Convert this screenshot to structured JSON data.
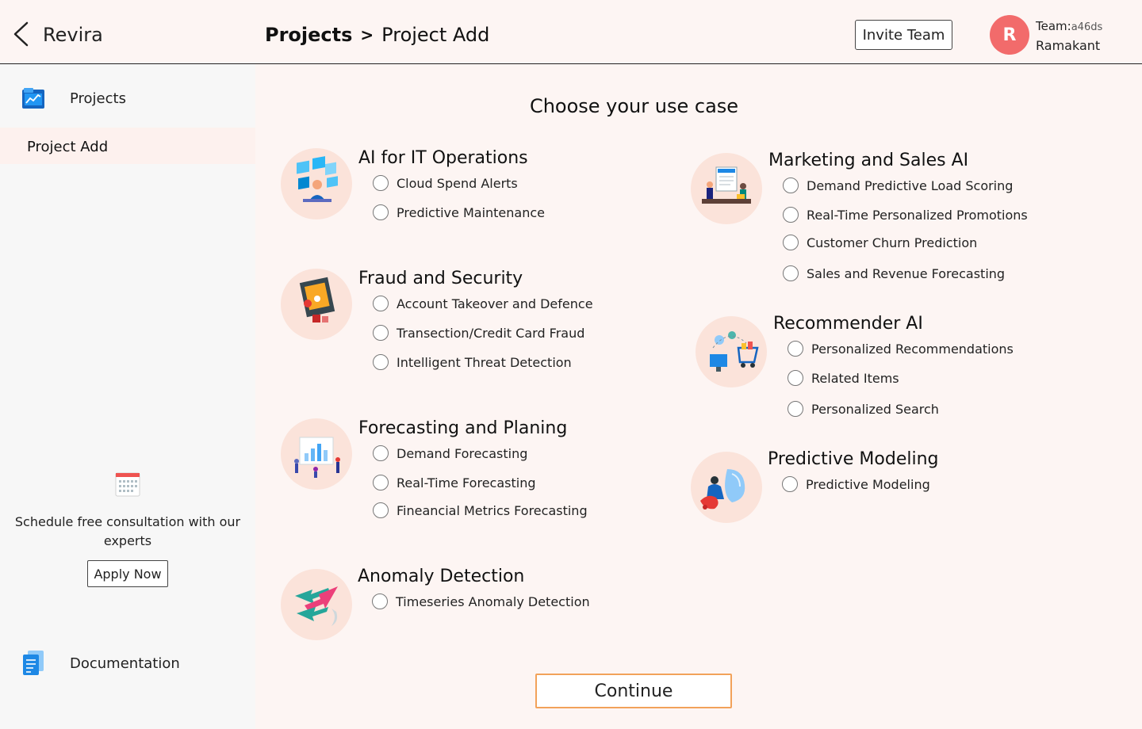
{
  "header": {
    "app_name": "Revira",
    "breadcrumb": {
      "parent": "Projects",
      "separator": ">",
      "current": "Project Add"
    },
    "invite_label": "Invite Team",
    "avatar_initial": "R",
    "team_prefix": "Team:",
    "team_id": "a46ds",
    "user_name": "Ramakant"
  },
  "sidebar": {
    "projects_label": "Projects",
    "project_add_label": "Project Add",
    "consult_text": "Schedule free consultation with our experts",
    "apply_label": "Apply Now",
    "docs_label": "Documentation"
  },
  "main": {
    "title": "Choose your use case",
    "groups": [
      {
        "title": "AI for IT Operations",
        "options": [
          "Cloud Spend Alerts",
          "Predictive Maintenance"
        ]
      },
      {
        "title": "Fraud and Security",
        "options": [
          "Account Takeover and Defence",
          "Transection/Credit Card Fraud",
          "Intelligent Threat Detection"
        ]
      },
      {
        "title": "Forecasting and Planing",
        "options": [
          "Demand Forecasting",
          "Real-Time Forecasting",
          "Fineancial Metrics Forecasting"
        ]
      },
      {
        "title": "Anomaly Detection",
        "options": [
          "Timeseries Anomaly Detection"
        ]
      },
      {
        "title": "Marketing and Sales AI",
        "options": [
          "Demand Predictive Load Scoring",
          "Real-Time Personalized Promotions",
          "Customer Churn Prediction",
          "Sales and Revenue Forecasting"
        ]
      },
      {
        "title": "Recommender AI",
        "options": [
          "Personalized Recommendations",
          "Related Items",
          "Personalized Search"
        ]
      },
      {
        "title": "Predictive Modeling",
        "options": [
          "Predictive Modeling"
        ]
      }
    ],
    "continue_label": "Continue"
  },
  "colors": {
    "accent": "#f26b6b",
    "continue_border": "#f2a25a",
    "illustration_bg": "#fbe3da",
    "page_bg": "#fdf5f3",
    "sidebar_bg": "#f7f7f7"
  }
}
